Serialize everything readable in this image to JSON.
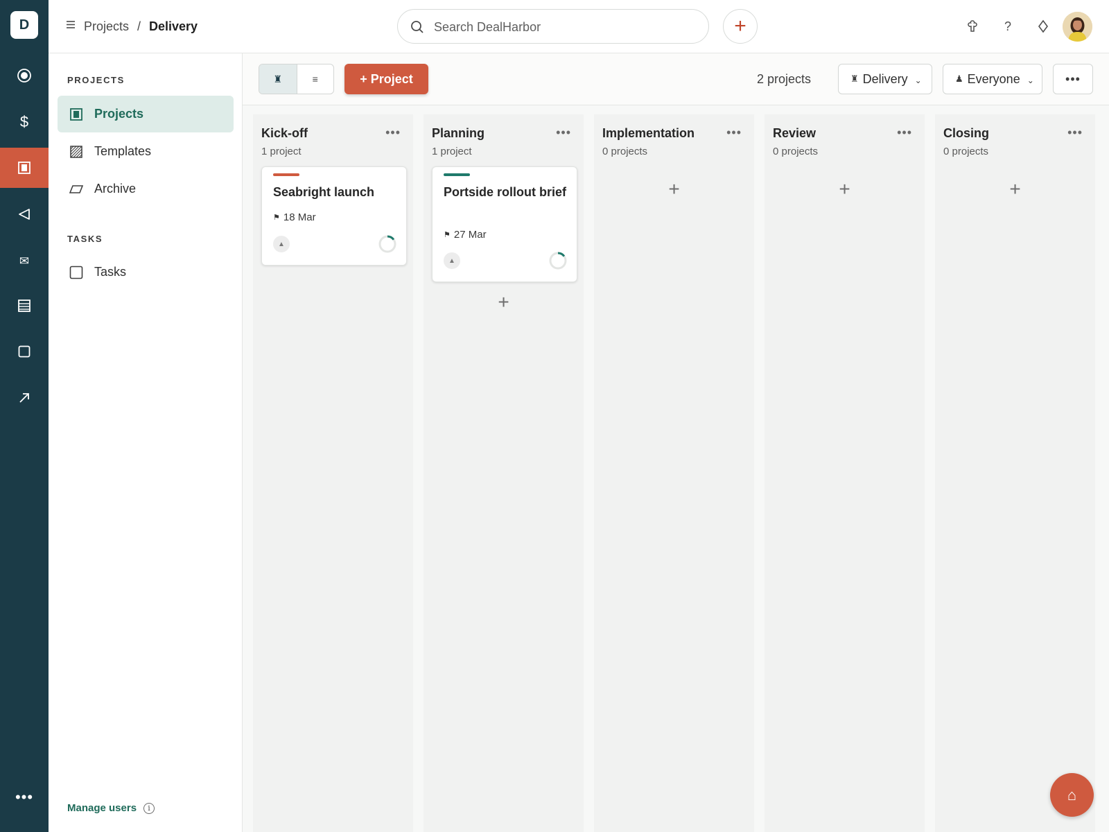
{
  "app": {
    "logo_letter": "D",
    "accent_color": "#cf5a3f",
    "rail_color": "#1b3b47",
    "brand_green": "#1f6b5a"
  },
  "rail": {
    "items": [
      {
        "name": "dashboard",
        "icon": "target-icon"
      },
      {
        "name": "deals",
        "icon": "dollar-icon"
      },
      {
        "name": "projects",
        "icon": "projects-icon",
        "active": true
      },
      {
        "name": "campaigns",
        "icon": "send-icon"
      },
      {
        "name": "mail",
        "icon": "mail-icon"
      },
      {
        "name": "reports",
        "icon": "table-icon"
      },
      {
        "name": "products",
        "icon": "box-icon"
      },
      {
        "name": "insights",
        "icon": "trend-arrow-icon"
      }
    ],
    "more_label": "•••"
  },
  "topbar": {
    "breadcrumb_root": "Projects",
    "breadcrumb_sep": "/",
    "breadcrumb_current": "Delivery",
    "search_placeholder": "Search DealHarbor",
    "add_label": "+",
    "icons": [
      "marketplace-icon",
      "help-icon",
      "upgrade-icon"
    ],
    "help_label": "?"
  },
  "sidenav": {
    "projects_section": "PROJECTS",
    "items": [
      {
        "label": "Projects",
        "icon": "board-icon",
        "active": true
      },
      {
        "label": "Templates",
        "icon": "templates-icon"
      },
      {
        "label": "Archive",
        "icon": "archive-icon"
      }
    ],
    "tasks_section": "TASKS",
    "tasks_item": {
      "label": "Tasks",
      "icon": "checkbox-icon"
    },
    "manage_users": "Manage users",
    "info_glyph": "i"
  },
  "toolbar": {
    "view_board_glyph": "♜",
    "view_list_glyph": "≡",
    "new_project_label": "+ Project",
    "count_text": "2 projects",
    "pipeline_filter": "Delivery",
    "pipeline_glyph": "♜",
    "owner_filter": "Everyone",
    "owner_glyph": "♟",
    "chevron": "⌄",
    "more_label": "•••"
  },
  "board": {
    "columns": [
      {
        "title": "Kick-off",
        "count": "1 project",
        "menu": "•••",
        "cards": [
          {
            "title": "Seabright launch",
            "date": "18 Mar",
            "bar_color": "#cf5a3f",
            "progress": 0.15
          }
        ]
      },
      {
        "title": "Planning",
        "count": "1 project",
        "menu": "•••",
        "cards": [
          {
            "title": "Portside rollout brief",
            "date": "27 Mar",
            "bar_color": "#1f7a6b",
            "progress": 0.15
          }
        ]
      },
      {
        "title": "Implementation",
        "count": "0 projects",
        "menu": "•••",
        "cards": []
      },
      {
        "title": "Review",
        "count": "0 projects",
        "menu": "•••",
        "cards": []
      },
      {
        "title": "Closing",
        "count": "0 projects",
        "menu": "•••",
        "cards": []
      }
    ],
    "add_glyph": "+",
    "flag_glyph": "⚑",
    "owner_glyph": "▲"
  },
  "fab": {
    "glyph": "⌂",
    "icon": "home-icon"
  }
}
